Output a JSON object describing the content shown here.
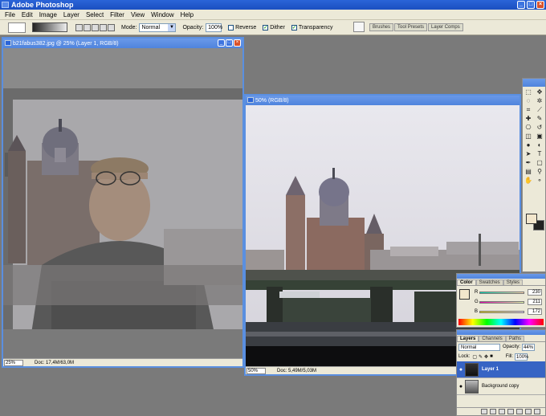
{
  "app": {
    "title": "Adobe Photoshop"
  },
  "menu": [
    "File",
    "Edit",
    "Image",
    "Layer",
    "Select",
    "Filter",
    "View",
    "Window",
    "Help"
  ],
  "options": {
    "mode_label": "Mode:",
    "mode_value": "Normal",
    "opacity_label": "Opacity:",
    "opacity_value": "100%",
    "reverse_label": "Reverse",
    "dither_label": "Dither",
    "transparency_label": "Transparency",
    "palette_tabs": [
      "Brushes",
      "Tool Presets",
      "Layer Comps"
    ]
  },
  "doc1": {
    "title": "b21fabus382.jpg @ 25% (Layer 1, RGB/8)",
    "zoom": "25%",
    "doc_info": "Doc: 17,4M/63,0M"
  },
  "doc2": {
    "title": "50% (RGB/8)",
    "zoom": "50%",
    "doc_info": "Doc: 5,49M/5,03M"
  },
  "color_palette": {
    "tabs": [
      "Color",
      "Swatches",
      "Styles"
    ],
    "channels": [
      {
        "name": "R",
        "value": "230"
      },
      {
        "name": "G",
        "value": "211"
      },
      {
        "name": "B",
        "value": "172"
      }
    ]
  },
  "layers_palette": {
    "tabs": [
      "Layers",
      "Channels",
      "Paths"
    ],
    "blend_mode": "Normal",
    "opacity_label": "Opacity:",
    "opacity_value": "44%",
    "lock_label": "Lock:",
    "fill_label": "Fill:",
    "fill_value": "100%",
    "layers": [
      {
        "name": "Layer 1",
        "active": true
      },
      {
        "name": "Background copy",
        "active": false
      }
    ]
  },
  "colors": {
    "accent": "#2a64d8",
    "foreground": "#f2e6cc",
    "background": "#222222",
    "selection": "#3764c4"
  }
}
